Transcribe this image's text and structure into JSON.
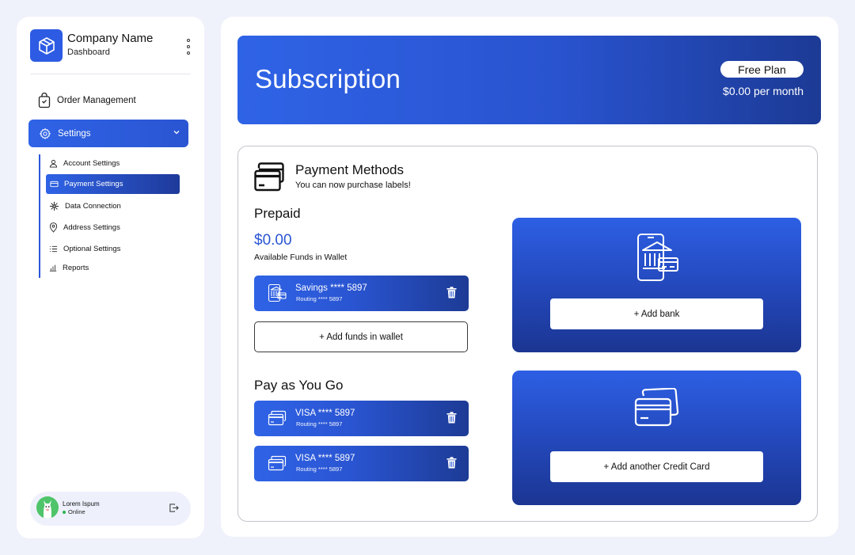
{
  "sidebar": {
    "brand": {
      "name": "Company Name",
      "subtitle": "Dashboard",
      "logo_icon": "box-icon"
    },
    "menu_icon": "kebab-menu-icon",
    "nav": {
      "order_management": "Order Management",
      "settings": "Settings"
    },
    "settings_items": [
      {
        "label": "Account Settings",
        "icon": "user-icon"
      },
      {
        "label": "Payment Settings",
        "icon": "credit-card-icon",
        "active": true
      },
      {
        "label": "Data Connection",
        "icon": "network-icon"
      },
      {
        "label": "Address Settings",
        "icon": "location-pin-icon"
      },
      {
        "label": "Optional Settings",
        "icon": "list-icon"
      },
      {
        "label": "Reports",
        "icon": "bar-chart-icon"
      }
    ],
    "user": {
      "name": "Lorem Ispum",
      "status": "Online"
    }
  },
  "subscription": {
    "title": "Subscription",
    "plan": "Free Plan",
    "price": "$0.00 per month"
  },
  "payment_methods": {
    "title": "Payment Methods",
    "subtitle": "You can now purchase labels!",
    "prepaid": {
      "title": "Prepaid",
      "amount": "$0.00",
      "amount_label": "Available Funds in Wallet",
      "accounts": [
        {
          "name": "Savings **** 5897",
          "routing": "Routing **** 5897"
        }
      ],
      "add_funds_label": "+  Add funds in wallet"
    },
    "pay_as_you_go": {
      "title": "Pay as You Go",
      "cards": [
        {
          "name": "VISA **** 5897",
          "routing": "Routing **** 5897"
        },
        {
          "name": "VISA **** 5897",
          "routing": "Routing **** 5897"
        }
      ]
    },
    "add_bank_label": "+  Add bank",
    "add_card_label": "+  Add another Credit Card"
  },
  "colors": {
    "accent": "#2f63e6",
    "accent_dark": "#1c3a95",
    "background": "#eff1fb"
  }
}
